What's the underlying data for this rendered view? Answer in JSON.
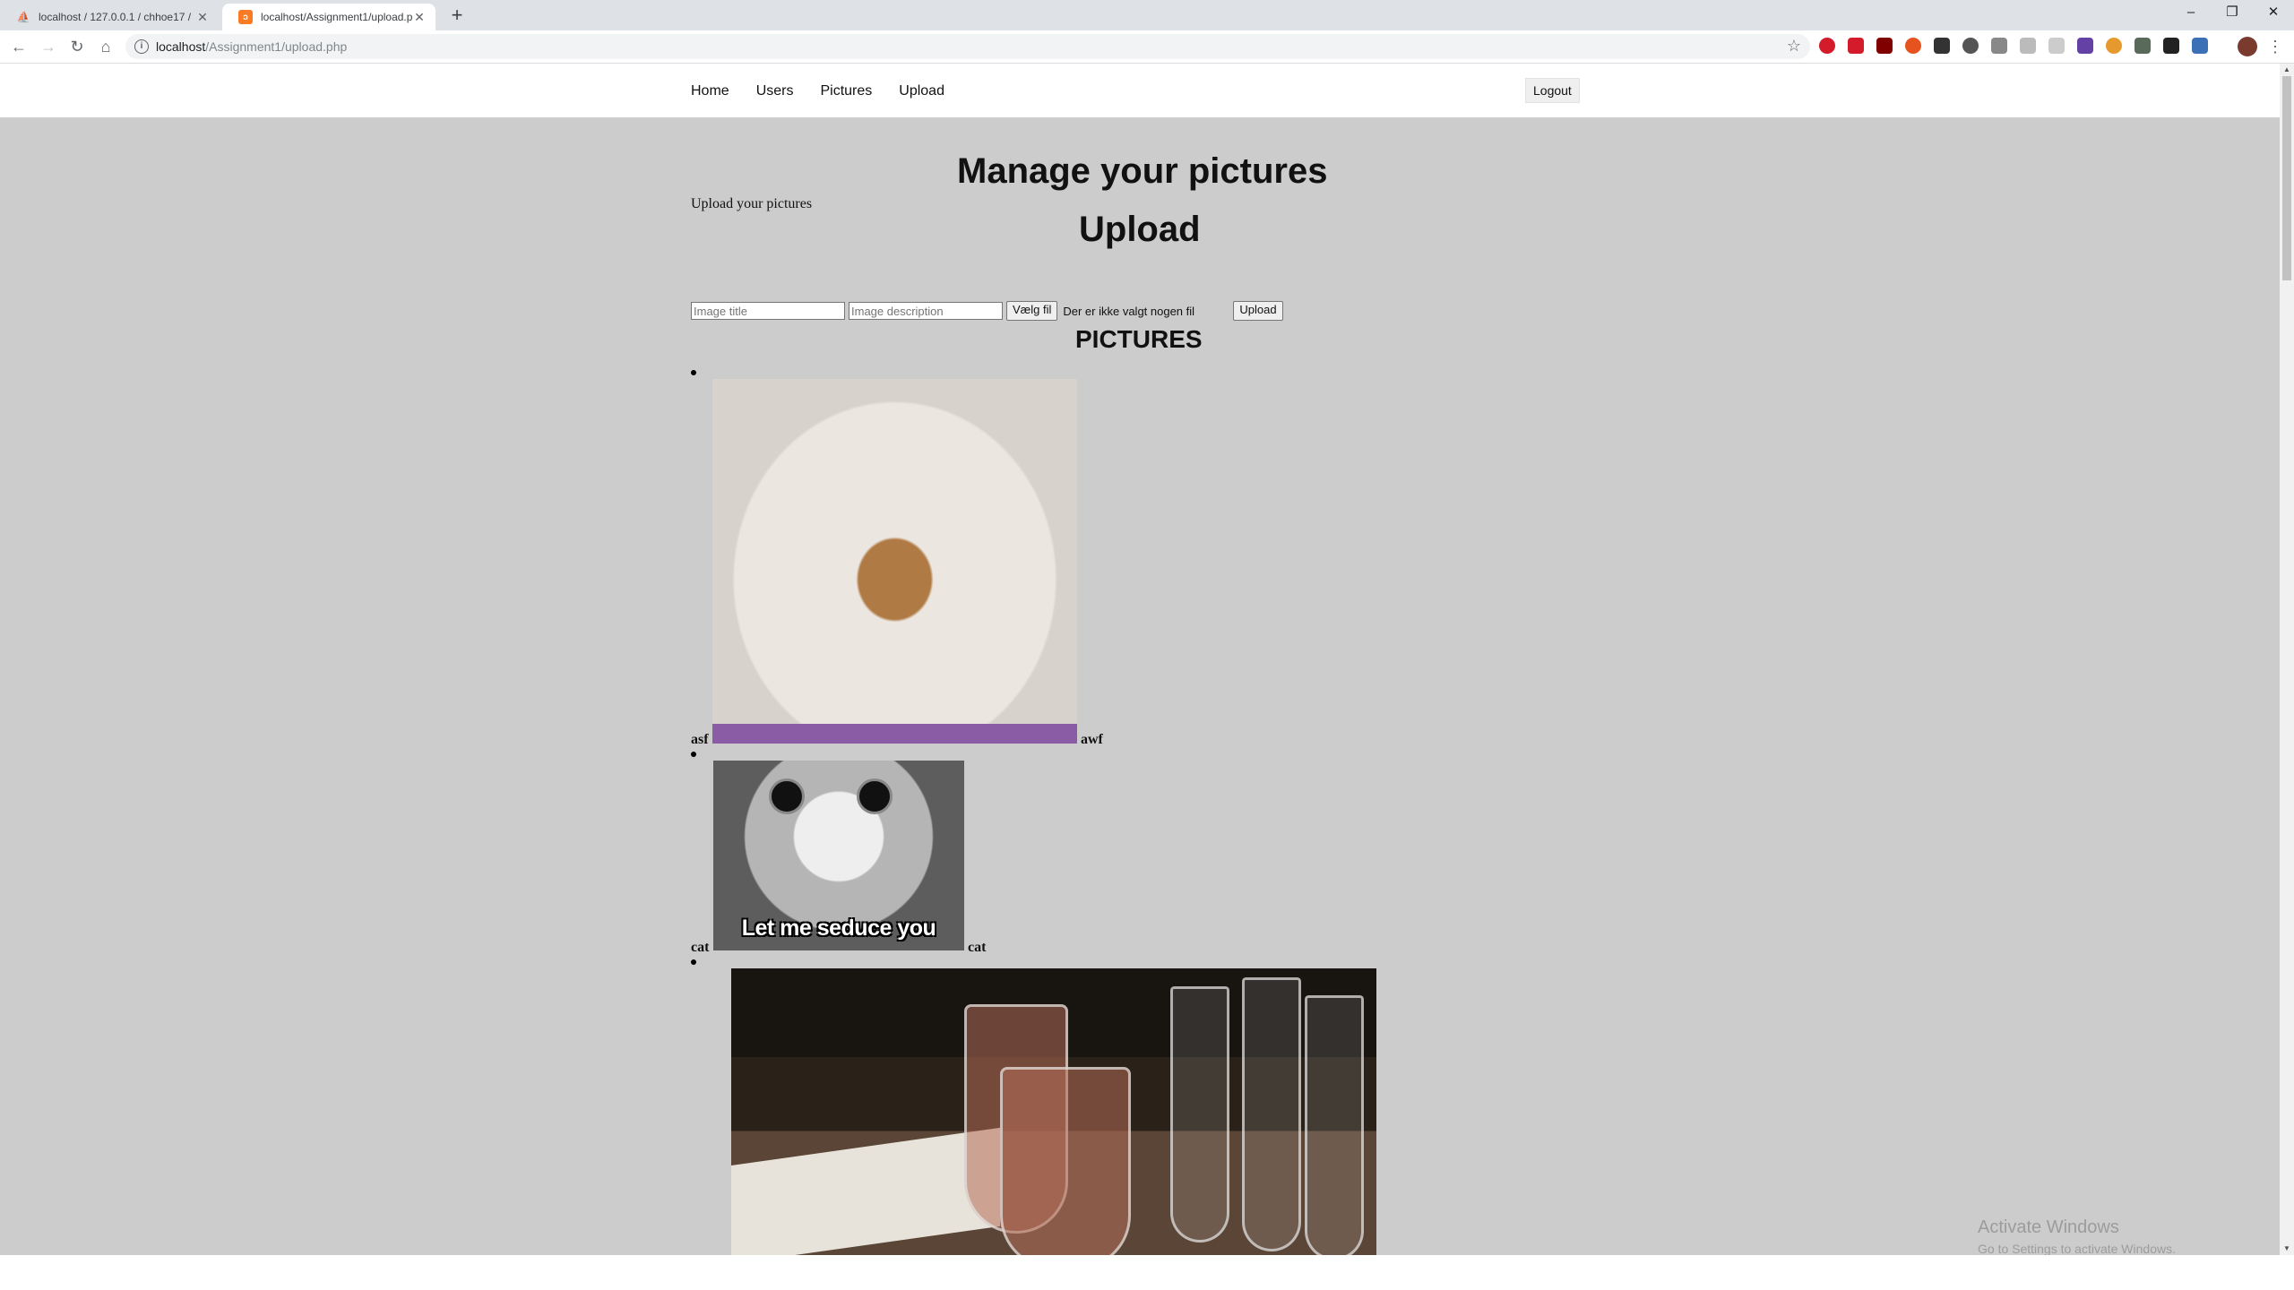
{
  "browser": {
    "tabs": [
      {
        "title": "localhost / 127.0.0.1 / chhoe17 /",
        "active": false
      },
      {
        "title": "localhost/Assignment1/upload.p",
        "active": true
      }
    ],
    "new_tab_symbol": "+",
    "url_host": "localhost",
    "url_path": "/Assignment1/upload.php",
    "window_controls": [
      "–",
      "❐",
      "✕"
    ]
  },
  "site_nav": {
    "links": [
      "Home",
      "Users",
      "Pictures",
      "Upload"
    ],
    "logout_label": "Logout"
  },
  "page": {
    "heading": "Manage your pictures",
    "subtext": "Upload your pictures",
    "upload_heading": "Upload",
    "form": {
      "title_placeholder": "Image title",
      "description_placeholder": "Image description",
      "file_button": "Vælg fil",
      "no_file_text": "Der er ikke valgt nogen fil",
      "submit_label": "Upload"
    },
    "pictures_heading": "PICTURES",
    "pictures": [
      {
        "title": "asf",
        "description": "awf",
        "image": "photo of a small animal peeking out of a white fleece pouch"
      },
      {
        "title": "cat",
        "description": "cat",
        "image": "grey and white kitten meme",
        "overlay_text": "Let me seduce you"
      },
      {
        "title": "",
        "description": "",
        "image": "photo of beer glasses and a menu on a restaurant table"
      }
    ]
  },
  "os": {
    "watermark_title": "Activate Windows",
    "watermark_sub": "Go to Settings to activate Windows."
  }
}
